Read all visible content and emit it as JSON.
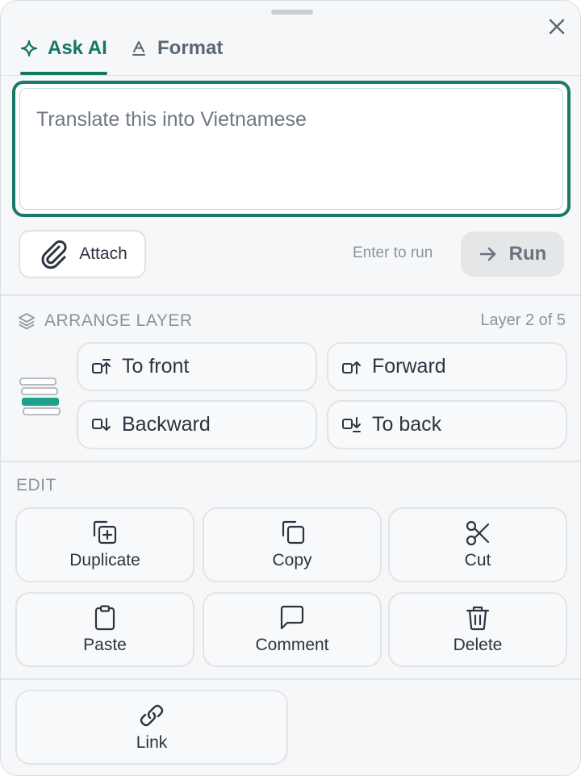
{
  "tabs": [
    {
      "label": "Ask AI",
      "icon": "sparkle-icon",
      "active": true
    },
    {
      "label": "Format",
      "icon": "text-format-icon",
      "active": false
    }
  ],
  "prompt": {
    "placeholder": "Translate this into Vietnamese",
    "value": ""
  },
  "actions": {
    "attach_label": "Attach",
    "enter_hint": "Enter to run",
    "run_label": "Run"
  },
  "arrange": {
    "title": "ARRANGE LAYER",
    "layer_count": "Layer 2 of 5",
    "buttons": [
      {
        "label": "To front",
        "icon": "bring-to-front-icon"
      },
      {
        "label": "Forward",
        "icon": "bring-forward-icon"
      },
      {
        "label": "Backward",
        "icon": "send-backward-icon"
      },
      {
        "label": "To back",
        "icon": "send-to-back-icon"
      }
    ]
  },
  "edit": {
    "title": "EDIT",
    "buttons": [
      {
        "label": "Duplicate",
        "icon": "duplicate-icon"
      },
      {
        "label": "Copy",
        "icon": "copy-icon"
      },
      {
        "label": "Cut",
        "icon": "scissors-icon"
      },
      {
        "label": "Paste",
        "icon": "clipboard-icon"
      },
      {
        "label": "Comment",
        "icon": "comment-icon"
      },
      {
        "label": "Delete",
        "icon": "trash-icon"
      },
      {
        "label": "Link",
        "icon": "link-icon"
      }
    ]
  },
  "colors": {
    "accent": "#127763",
    "background": "#f6f7f8",
    "muted_text": "#8a939c"
  }
}
